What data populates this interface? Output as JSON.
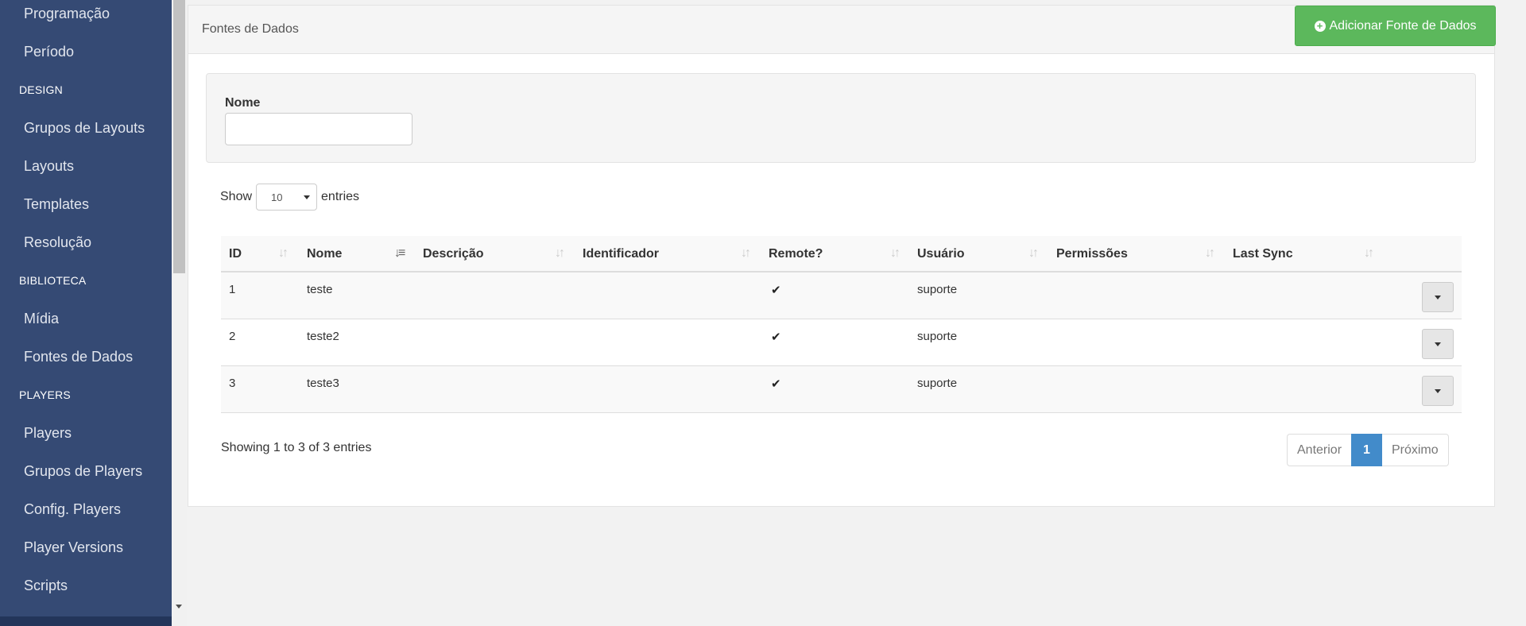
{
  "sidebar": {
    "items": [
      {
        "type": "item",
        "label": "Programação"
      },
      {
        "type": "item",
        "label": "Período"
      },
      {
        "type": "heading",
        "label": "DESIGN"
      },
      {
        "type": "item",
        "label": "Grupos de Layouts"
      },
      {
        "type": "item",
        "label": "Layouts"
      },
      {
        "type": "item",
        "label": "Templates"
      },
      {
        "type": "item",
        "label": "Resolução"
      },
      {
        "type": "heading",
        "label": "BIBLIOTECA"
      },
      {
        "type": "item",
        "label": "Mídia"
      },
      {
        "type": "item",
        "label": "Fontes de Dados"
      },
      {
        "type": "heading",
        "label": "PLAYERS"
      },
      {
        "type": "item",
        "label": "Players"
      },
      {
        "type": "item",
        "label": "Grupos de Players"
      },
      {
        "type": "item",
        "label": "Config. Players"
      },
      {
        "type": "item",
        "label": "Player Versions"
      },
      {
        "type": "item",
        "label": "Scripts"
      }
    ]
  },
  "panel": {
    "title": "Fontes de Dados",
    "add_button_label": "Adicionar Fonte de Dados"
  },
  "filter": {
    "name_label": "Nome",
    "name_value": ""
  },
  "length": {
    "show_label": "Show",
    "selected": "10",
    "entries_label": "entries"
  },
  "table": {
    "columns": [
      "ID",
      "Nome",
      "Descrição",
      "Identificador",
      "Remote?",
      "Usuário",
      "Permissões",
      "Last Sync"
    ],
    "rows": [
      {
        "id": "1",
        "nome": "teste",
        "descricao": "",
        "identificador": "",
        "remote": "✔",
        "usuario": "suporte",
        "permissoes": "",
        "last_sync": ""
      },
      {
        "id": "2",
        "nome": "teste2",
        "descricao": "",
        "identificador": "",
        "remote": "✔",
        "usuario": "suporte",
        "permissoes": "",
        "last_sync": ""
      },
      {
        "id": "3",
        "nome": "teste3",
        "descricao": "",
        "identificador": "",
        "remote": "✔",
        "usuario": "suporte",
        "permissoes": "",
        "last_sync": ""
      }
    ]
  },
  "info": "Showing 1 to 3 of 3 entries",
  "pagination": {
    "prev": "Anterior",
    "current": "1",
    "next": "Próximo"
  },
  "colors": {
    "sidebar_bg": "#354a74",
    "add_button": "#5cb85c",
    "active_page": "#428bca"
  }
}
